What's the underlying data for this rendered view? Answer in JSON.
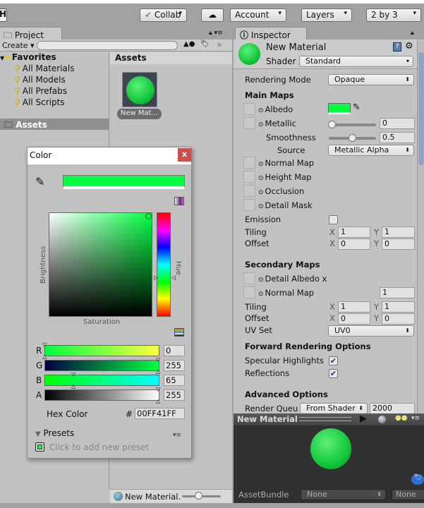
{
  "toolbar": {
    "collab": "Collab",
    "account": "Account",
    "layers": "Layers",
    "layout": "2 by 3"
  },
  "project": {
    "tab": "Project",
    "create": "Create",
    "search_placeholder": "",
    "favorites": "Favorites",
    "favorite_items": [
      "All Materials",
      "All Models",
      "All Prefabs",
      "All Scripts"
    ],
    "assets_folder": "Assets",
    "assets_header": "Assets",
    "asset_item": "New Mat...",
    "footer_item": "New Material."
  },
  "inspector": {
    "tab": "Inspector",
    "title": "New Material",
    "shader_label": "Shader",
    "shader": "Standard",
    "rendering_mode_label": "Rendering Mode",
    "rendering_mode": "Opaque",
    "main_maps": "Main Maps",
    "albedo": "Albedo",
    "albedo_color": "#00FF41",
    "metallic": "Metallic",
    "metallic_value": "0",
    "smoothness": "Smoothness",
    "smoothness_value": "0.5",
    "source": "Source",
    "source_value": "Metallic Alpha",
    "normal_map": "Normal Map",
    "height_map": "Height Map",
    "occlusion": "Occlusion",
    "detail_mask": "Detail Mask",
    "emission": "Emission",
    "tiling": "Tiling",
    "offset": "Offset",
    "x": "X",
    "y": "Y",
    "main_tiling": [
      "1",
      "1"
    ],
    "main_offset": [
      "0",
      "0"
    ],
    "secondary_maps": "Secondary Maps",
    "detail_albedo": "Detail Albedo x",
    "sec_normal_map": "Normal Map",
    "sec_normal_value": "1",
    "sec_tiling": [
      "1",
      "1"
    ],
    "sec_offset": [
      "0",
      "0"
    ],
    "uv_set_label": "UV Set",
    "uv_set": "UV0",
    "forward": "Forward Rendering Options",
    "specular": "Specular Highlights",
    "specular_checked": true,
    "reflections": "Reflections",
    "reflections_checked": true,
    "advanced": "Advanced Options",
    "render_queue": "Render Queu",
    "render_queue_mode": "From Shader",
    "render_queue_value": "2000"
  },
  "preview": {
    "title": "New Material",
    "assetbundle_label": "AssetBundle",
    "bundle": "None",
    "variant": "None"
  },
  "color_picker": {
    "title": "Color",
    "close": "x",
    "saturation": "Saturation",
    "brightness": "Brightness",
    "hue": "Hue",
    "channels": [
      {
        "label": "R",
        "value": "0",
        "fraction": 0
      },
      {
        "label": "G",
        "value": "255",
        "fraction": 1
      },
      {
        "label": "B",
        "value": "65",
        "fraction": 0.255
      },
      {
        "label": "A",
        "value": "255",
        "fraction": 1
      }
    ],
    "hex_label": "Hex Color",
    "hash": "#",
    "hex": "00FF41FF",
    "presets": "Presets",
    "add_preset": "Click to add new preset",
    "color": "#00FF41"
  }
}
